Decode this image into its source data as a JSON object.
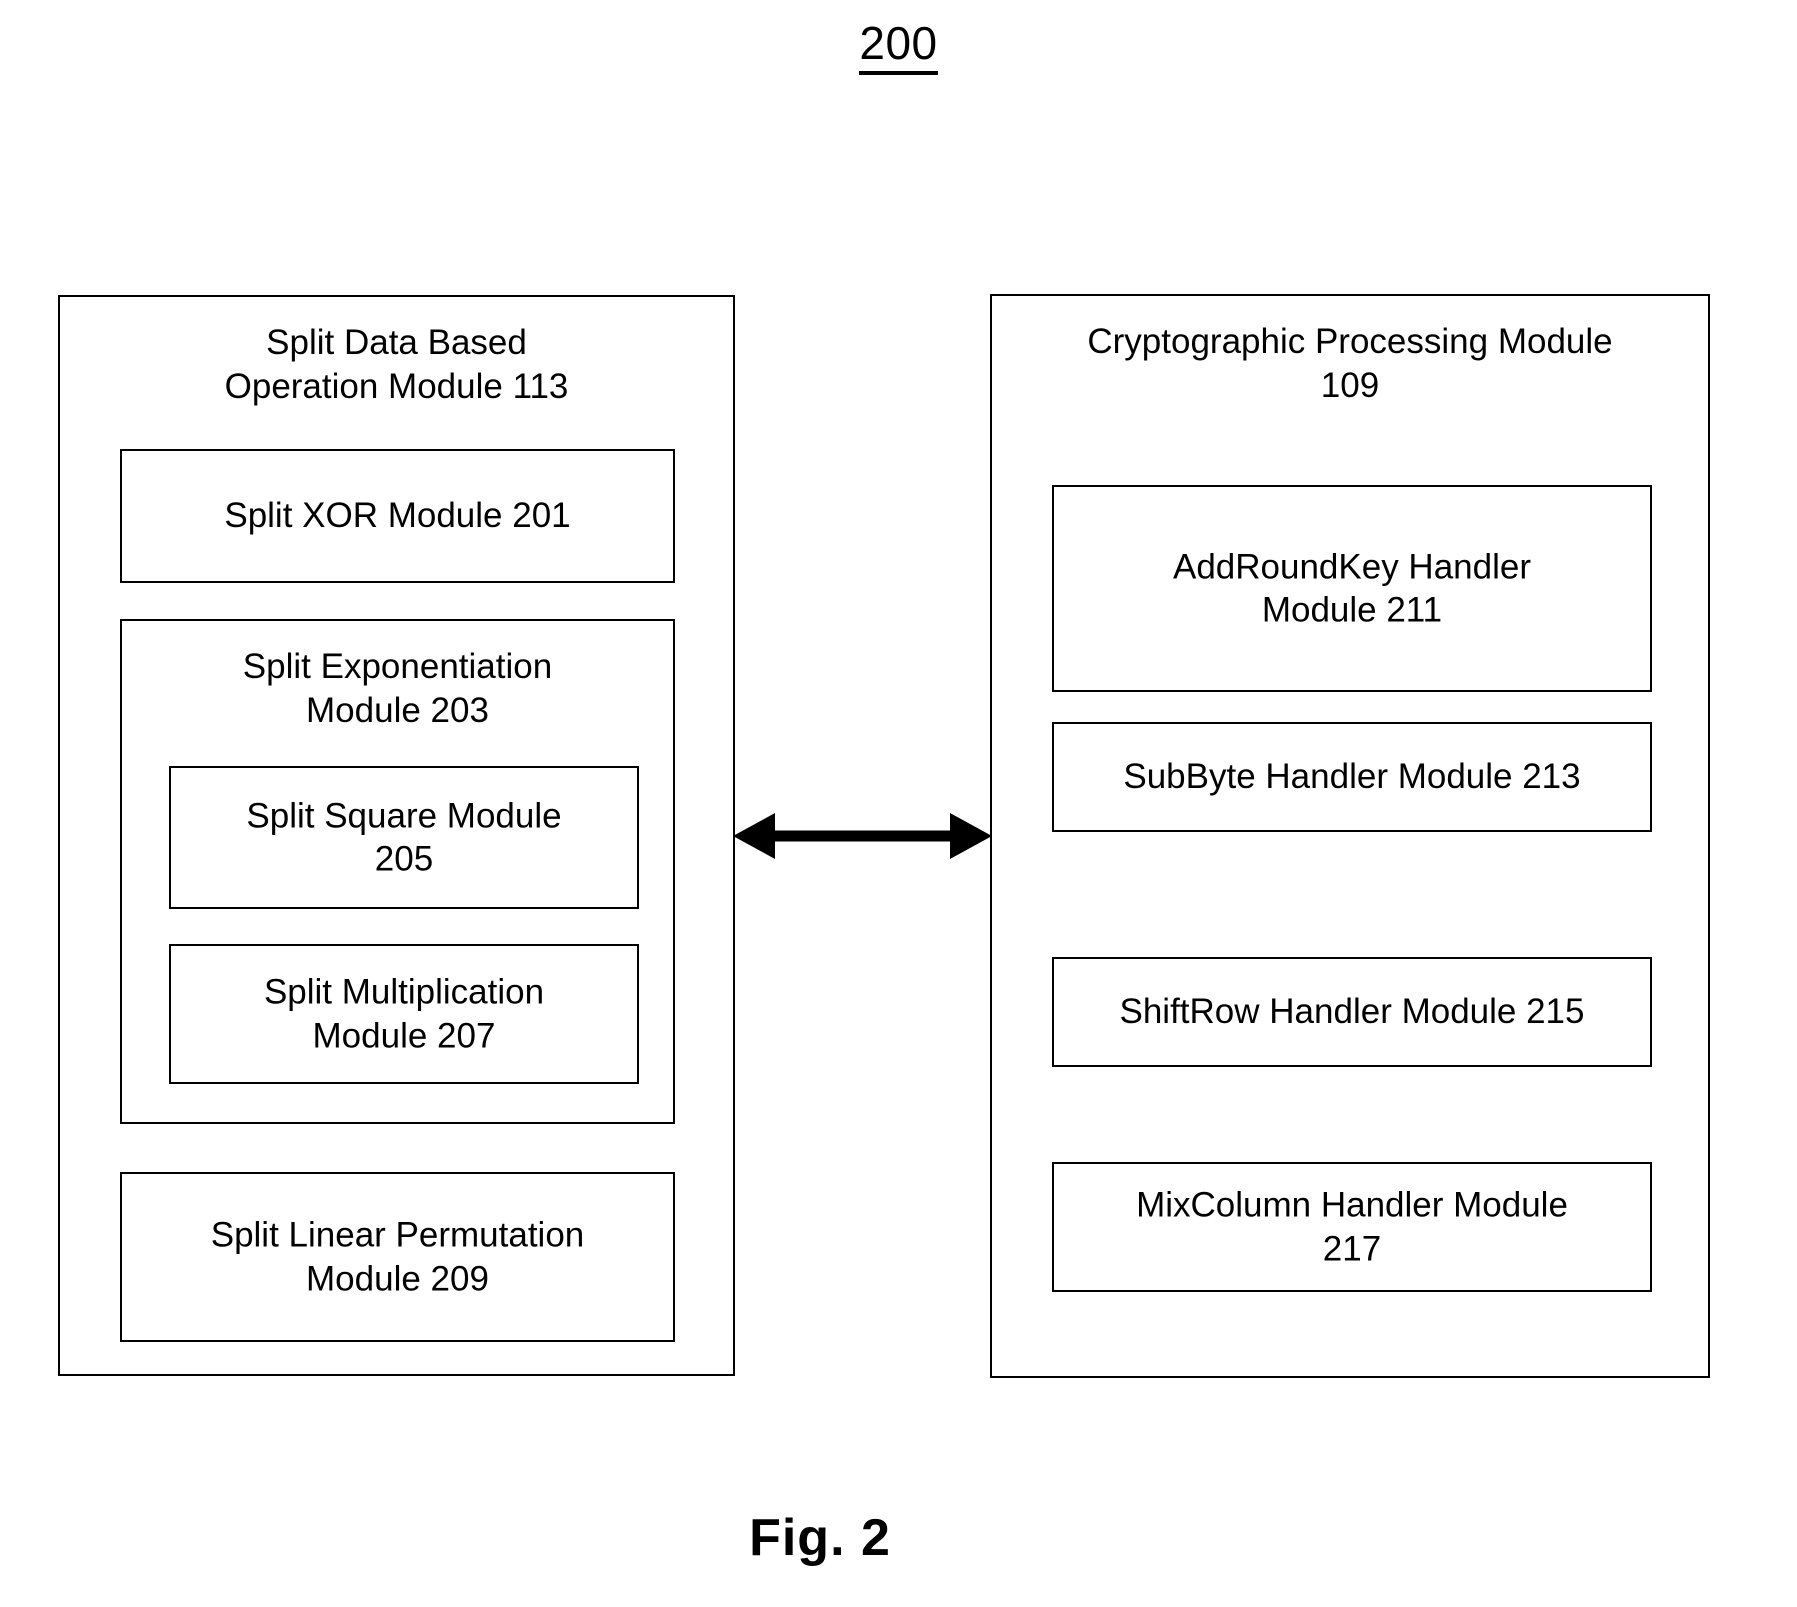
{
  "figure": {
    "number": "200",
    "caption": "Fig. 2"
  },
  "left_module": {
    "title": "Split Data Based\nOperation Module 113",
    "title_line1": "Split Data Based",
    "title_line2": "Operation Module 113",
    "children": [
      {
        "label": "Split XOR Module 201"
      },
      {
        "label": "Split Exponentiation\nModule 203",
        "label_line1": "Split Exponentiation",
        "label_line2": "Module 203",
        "children": [
          {
            "label": "Split Square Module\n205"
          },
          {
            "label": "Split Multiplication\nModule 207"
          }
        ]
      },
      {
        "label": "Split Linear Permutation\nModule 209"
      }
    ]
  },
  "right_module": {
    "title": "Cryptographic Processing Module\n109",
    "title_line1": "Cryptographic Processing Module",
    "title_line2": "109",
    "children": [
      {
        "label": "AddRoundKey Handler\nModule 211"
      },
      {
        "label": "SubByte Handler Module 213"
      },
      {
        "label": "ShiftRow Handler Module 215"
      },
      {
        "label": "MixColumn Handler Module\n217"
      }
    ]
  },
  "connector": {
    "kind": "bidirectional-arrow",
    "label": ""
  },
  "colors": {
    "background": "#ffffff",
    "stroke": "#000000",
    "text": "#000000"
  }
}
